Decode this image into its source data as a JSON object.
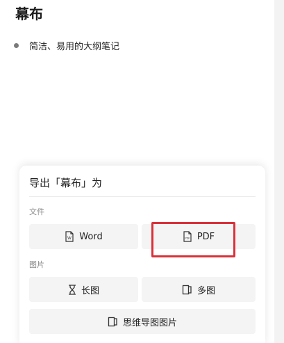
{
  "document": {
    "title": "幕布",
    "bullet_text": "简洁、易用的大纲笔记"
  },
  "export_sheet": {
    "title": "导出「幕布」为",
    "file_section_label": "文件",
    "word_label": "Word",
    "pdf_label": "PDF",
    "image_section_label": "图片",
    "long_image_label": "长图",
    "multi_image_label": "多图",
    "mindmap_image_label": "思维导图图片"
  },
  "colors": {
    "highlight": "#d8313a",
    "button_bg": "#f4f4f4"
  }
}
